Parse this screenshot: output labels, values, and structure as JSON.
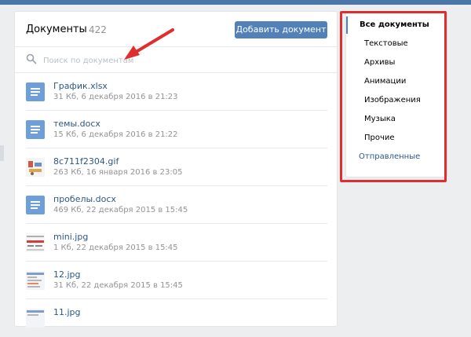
{
  "header": {
    "title": "Документы",
    "count": "422",
    "add_button": "Добавить документ"
  },
  "search": {
    "placeholder": "Поиск по документам"
  },
  "documents": [
    {
      "name": "График.xlsx",
      "meta": "31 Кб, 6 декабря 2016 в 21:23",
      "icon": "doc-icon"
    },
    {
      "name": "темы.docx",
      "meta": "15 Кб, 6 декабря 2016 в 21:22",
      "icon": "doc-icon"
    },
    {
      "name": "8c711f2304.gif",
      "meta": "263 Кб, 16 января 2016 в 23:05",
      "icon": "image-thumbnail"
    },
    {
      "name": "пробелы.docx",
      "meta": "469 Кб, 22 декабря 2015 в 15:45",
      "icon": "doc-icon"
    },
    {
      "name": "mini.jpg",
      "meta": "1 Кб, 22 декабря 2015 в 15:45",
      "icon": "image-thumbnail"
    },
    {
      "name": "12.jpg",
      "meta": "31 Кб, 22 декабря 2015 в 15:45",
      "icon": "image-thumbnail"
    },
    {
      "name": "11.jpg",
      "meta": "",
      "icon": "image-thumbnail"
    }
  ],
  "filter_menu": {
    "items": [
      {
        "label": "Все документы",
        "active": true
      },
      {
        "label": "Текстовые"
      },
      {
        "label": "Архивы"
      },
      {
        "label": "Анимации"
      },
      {
        "label": "Изображения"
      },
      {
        "label": "Музыка"
      },
      {
        "label": "Прочие"
      },
      {
        "label": "Отправленные",
        "link": true
      }
    ]
  },
  "colors": {
    "accent": "#5181b8",
    "link": "#2a5885",
    "highlight": "#e02d2d",
    "background": "#edeef0"
  }
}
